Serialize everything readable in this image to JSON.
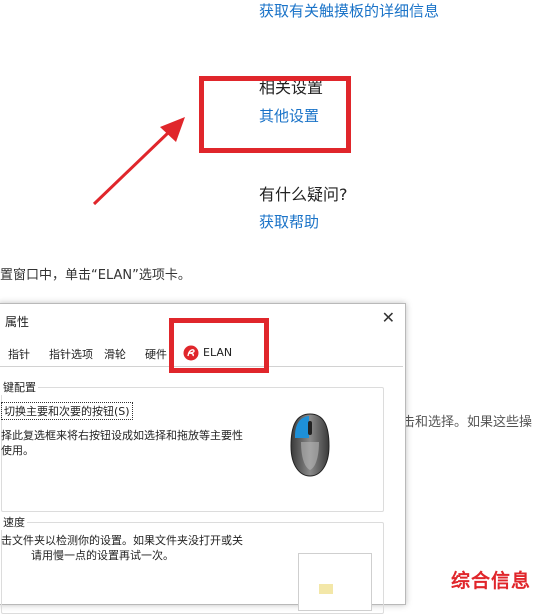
{
  "settings_page": {
    "touchpad_info_link": "获取有关触摸板的详细信息",
    "related_settings_heading": "相关设置",
    "other_settings_link": "其他设置",
    "questions_heading": "有什么疑问?",
    "get_help_link": "获取帮助"
  },
  "instruction_text": "置窗口中，单击“ELAN”选项卡。",
  "background_text_right": "击和选择。如果这些操",
  "dialog": {
    "title": "属性",
    "close_glyph": "✕",
    "tabs": [
      "指针",
      "指针选项",
      "滑轮",
      "硬件",
      "ELAN"
    ],
    "button_config_group": "键配置",
    "swap_buttons_checkbox": "切换主要和次要的按钮(S)",
    "swap_description_line1": "择此复选框来将右按钮设成如选择和拖放等主要性",
    "swap_description_line2": "使用。",
    "speed_group": "速度",
    "speed_description_line1": "击文件夹以检测你的设置。如果文件夹没打开或关",
    "speed_description_line2": "请用慢一点的设置再试一次。"
  },
  "watermark": "综合信息",
  "colors": {
    "link": "#1a73c8",
    "highlight_red": "#e0262b",
    "mouse_accent_blue": "#1e90d8"
  },
  "icons": {
    "elan_logo": "elan-logo-icon",
    "mouse": "mouse-icon",
    "close": "close-icon"
  }
}
